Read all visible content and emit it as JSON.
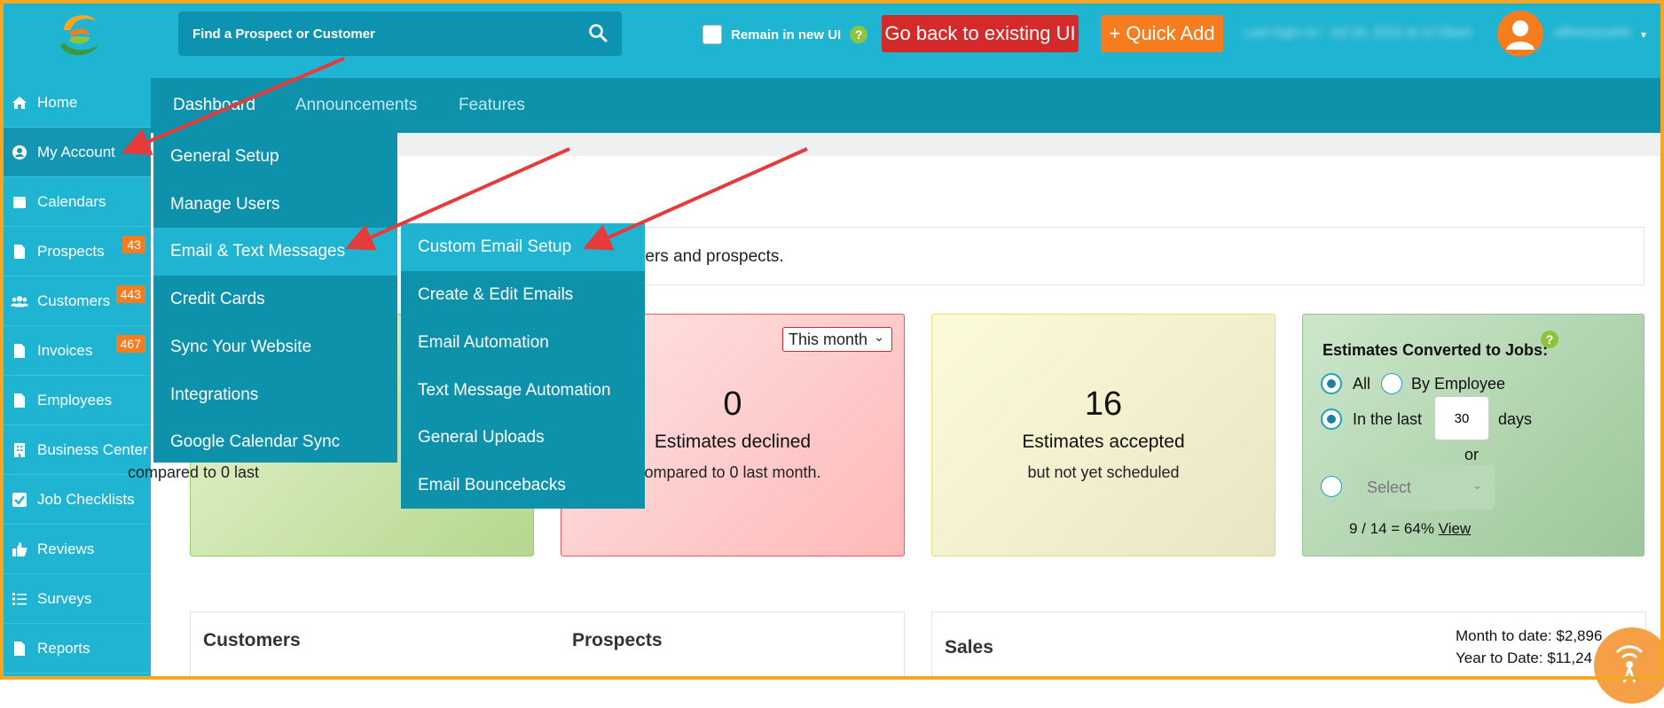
{
  "colors": {
    "accent": "#1fb4d2",
    "dark_accent": "#0e91ab",
    "orange": "#f57c1f",
    "red_button": "#d42a2a",
    "arrow": "#e53b3b"
  },
  "header": {
    "search_placeholder": "Find a Prospect or Customer",
    "remain_label": "Remain in new UI",
    "help_glyph": "?",
    "back_button": "Go back to existing UI",
    "quick_add": "+ Quick Add",
    "last_login": "Last login on : Jul 26, 2022 at 11:05am",
    "username": "wflorestcarlin",
    "caret": "▾"
  },
  "sidebar": {
    "items": [
      {
        "label": "Home",
        "icon": "home-icon",
        "badge": ""
      },
      {
        "label": "My Account",
        "icon": "user-circle-icon",
        "badge": ""
      },
      {
        "label": "Calendars",
        "icon": "calendar-icon",
        "badge": ""
      },
      {
        "label": "Prospects",
        "icon": "file-icon",
        "badge": "43"
      },
      {
        "label": "Customers",
        "icon": "users-icon",
        "badge": "443"
      },
      {
        "label": "Invoices",
        "icon": "file-icon",
        "badge": "467"
      },
      {
        "label": "Employees",
        "icon": "file-icon",
        "badge": ""
      },
      {
        "label": "Business Center",
        "icon": "building-icon",
        "badge": ""
      },
      {
        "label": "Job Checklists",
        "icon": "checkbox-icon",
        "badge": ""
      },
      {
        "label": "Reviews",
        "icon": "thumbs-up-icon",
        "badge": ""
      },
      {
        "label": "Surveys",
        "icon": "list-icon",
        "badge": ""
      },
      {
        "label": "Reports",
        "icon": "file-icon",
        "badge": ""
      }
    ]
  },
  "tabs": [
    "Dashboard",
    "Announcements",
    "Features"
  ],
  "menu_my_account": [
    "General Setup",
    "Manage Users",
    "Email & Text Messages",
    "Credit Cards",
    "Sync Your Website",
    "Integrations",
    "Google Calendar Sync"
  ],
  "menu_email": [
    "Custom Email Setup",
    "Create & Edit Emails",
    "Email Automation",
    "Text Message Automation",
    "General Uploads",
    "Email Bouncebacks"
  ],
  "message_text": "omers and prospects.",
  "cards": {
    "green": {
      "sub": "compared to 0 last"
    },
    "red": {
      "number": "0",
      "title": "Estimates declined",
      "sub": "ompared to 0 last month.",
      "select": "This month",
      "select_caret": "⌄"
    },
    "yellow": {
      "number": "16",
      "title": "Estimates accepted",
      "sub": "but not yet scheduled"
    },
    "conversion": {
      "title": "Estimates Converted to Jobs:",
      "all": "All",
      "by_employee": "By Employee",
      "in_the_last": "In the last",
      "days_value": "30",
      "days": "days",
      "or": "or",
      "select": "Select",
      "select_caret": "⌄",
      "ratio": "9 / 14 = 64% ",
      "view": "View"
    }
  },
  "bottom": {
    "customers": "Customers",
    "prospects": "Prospects",
    "sales": "Sales",
    "month_to_date": "Month to date: $2,896",
    "year_to_date": "Year to Date: $11,24"
  }
}
